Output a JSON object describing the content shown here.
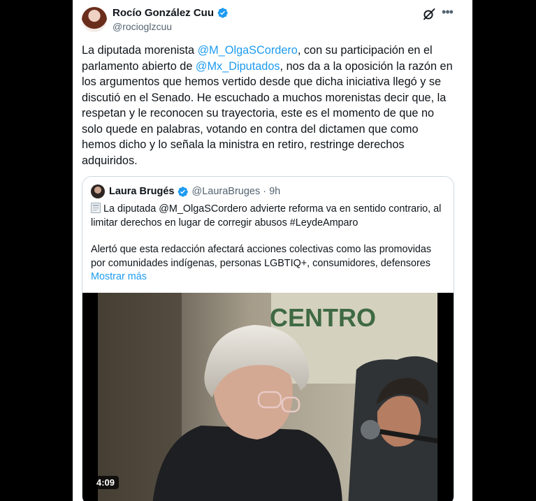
{
  "post": {
    "author_name": "Rocío González Cuu",
    "handle": "@rocioglzcuu",
    "text_parts": [
      {
        "t": "La diputada morenista "
      },
      {
        "t": "@M_OlgaSCordero",
        "mention": true
      },
      {
        "t": ", con su participación en el\nparlamento abierto de "
      },
      {
        "t": "@Mx_Diputados",
        "mention": true
      },
      {
        "t": ", nos  da a la oposición la razón en\nlos argumentos que hemos vertido desde que dicha iniciativa llegó y se\ndiscutió en el Senado. He escuchado a muchos morenistas decir que, la\nrespetan y le reconocen su trayectoria, este es el momento de que no\nsolo quede en palabras, votando en contra del dictamen que como\nhemos dicho y lo señala la ministra en retiro, restringe derechos\nadquiridos."
      }
    ]
  },
  "quoted": {
    "author_name": "Laura Brugés",
    "handle": "@LauraBruges",
    "separator": "·",
    "time": "9h",
    "line1": "La diputada @M_OlgaSCordero advierte reforma va en sentido contrario, al limitar derechos en lugar de corregir abusos #LeydeAmparo",
    "line2": "Alertó que esta redacción afectará acciones colectivas como las promovidas por comunidades indígenas, personas LGBTIQ+, consumidores, defensores",
    "show_more": "Mostrar más",
    "video_duration": "4:09",
    "backdrop_text": "CENTRO"
  },
  "icons": {
    "verified": "verified-badge-icon",
    "grok": "grok-icon",
    "more": "more-options-icon",
    "newspaper": "newspaper-emoji"
  },
  "colors": {
    "accent": "#1d9bf0",
    "text": "#0f1419",
    "muted": "#536471",
    "border": "#cfd9de"
  }
}
